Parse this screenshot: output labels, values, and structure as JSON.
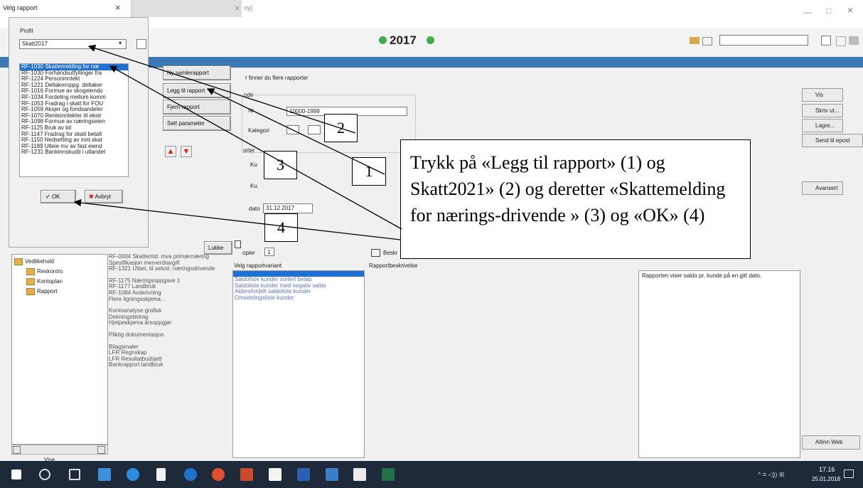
{
  "app": {
    "year": "2017",
    "hidden_title": "ny]"
  },
  "tab": {
    "title": "Velg rapport",
    "close": "×",
    "close2": "×"
  },
  "window_controls": {
    "minimize": "—",
    "maximize": "□",
    "close": "×"
  },
  "dialog": {
    "profile_label": "Profil",
    "profile_value": "Skatt2017",
    "reports": [
      "RF-1030 Skattemelding for næ",
      "RF-1030 Forhåndsutfyllinger fra",
      "RF-1224 Personinntekt",
      "RF-1221 Deltakeroppg. deltaker",
      "RF-1016 Formue av skogeiendo",
      "RF-1034 Fordeling mellom komm",
      "RF-1053 Fradrag i skatt for FOU",
      "RF-1059 Aksjer og fondsandeler",
      "RF-1070 Renteinntekter til ekstr",
      "RF-1098 Formue av næringseien",
      "RF-1125 Bruk av bil",
      "RF-1147 Fradrag for skatt betalt",
      "RF-1150 Nedsetting av innt.skat",
      "RF-1189 Utleie mv av fast eiend",
      "RF-1231 Bankinnskudd i utlandet"
    ],
    "ok": "OK",
    "cancel": "Avbryt"
  },
  "report_buttons": {
    "new_collection": "Ny samlerapport",
    "add_report": "Legg til rapport",
    "remove_report": "Fjern rapport",
    "set_parameter": "Sett parameter",
    "close": "Lukke"
  },
  "main": {
    "hint": "r finner du flere rapporter",
    "group_label": "nde",
    "nr_label": "Nr",
    "nr_value": "10000-1999",
    "category_label": "Kategori",
    "sort_label": "orter",
    "ku1": "Ku",
    "ku2": "Ku",
    "date_label": "dato",
    "date_value": "31.12.2017",
    "copies_label": "opier",
    "copies_value": "1",
    "desc_btn": "Beskr",
    "variant_header": "Velg rapportvariant",
    "variants": [
      "Saldoliste kunder sortert beløp",
      "Saldoliste kunder med negativ saldo",
      "Aldersfordelt saldoliste kunder",
      "Omsetningsliste kunder"
    ],
    "desc_header": "Rapportbeskrivelse",
    "desc_text": "Rapporten viser saldo pr. kunde på en gitt dato."
  },
  "side_buttons": {
    "view": "Vis",
    "print": "Skriv ut...",
    "save": "Lagre...",
    "send_email": "Send til epost",
    "advanced": "Avansert",
    "altinn": "Altinn Web"
  },
  "tree": {
    "items": [
      "Vedlikehold",
      "Reskontro",
      "Kontoplan",
      "Rapport"
    ],
    "footer": "Vise"
  },
  "report_list": [
    "RF-0004 Skattemld. mva primærnæring",
    "Spesifikasjon merverdiavgift",
    "RF-1321 Utbet. til selvst. næringsdrivende",
    "",
    "RF-1175 Næringsoppgave 1",
    "RF-1177 Landbruk",
    "RF-1084 Avskrivning",
    "Flere ligningsskjema...",
    "",
    "Kontoanalyse grafisk",
    "Dekningsbidrag",
    "Hjelpeskjema årsoppgjør",
    "",
    "Pliktig dokumentasjon",
    "",
    "Bilagsmaler",
    "LFR Regnskap",
    "LFR Resultatbudsjett",
    "Bankrapport landbruk"
  ],
  "callouts": {
    "n1": "1",
    "n2": "2",
    "n3": "3",
    "n4": "4",
    "text": "Trykk på «Legg til rapport» (1) og Skatt2021» (2) og deretter «Skattemelding for nærings-drivende » (3) og «OK» (4)"
  },
  "taskbar": {
    "time": "17.16",
    "date": "25.01.2018"
  },
  "colors": {
    "accent": "#3a78b6",
    "selection": "#1e6fd6",
    "taskbar": "#1e2a3a"
  }
}
